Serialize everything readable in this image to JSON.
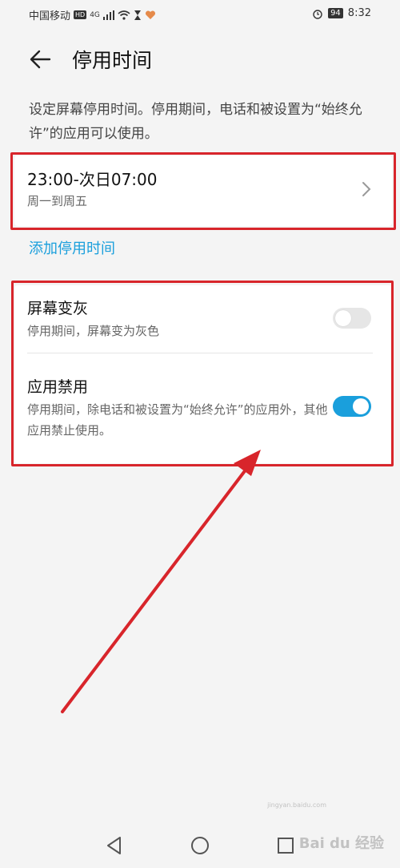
{
  "status_bar": {
    "carrier": "中国移动",
    "hd": "HD",
    "net": "4G",
    "battery": "94",
    "time": "8:32"
  },
  "header": {
    "title": "停用时间",
    "back_icon": "arrow-left-icon"
  },
  "description": "设定屏幕停用时间。停用期间，电话和被设置为“始终允许”的应用可以使用。",
  "schedule": {
    "time_range": "23:00-次日07:00",
    "days": "周一到周五"
  },
  "add_link": "添加停用时间",
  "settings": [
    {
      "title": "屏幕变灰",
      "subtitle": "停用期间，屏幕变为灰色",
      "enabled": false
    },
    {
      "title": "应用禁用",
      "subtitle": "停用期间，除电话和被设置为“始终允许”的应用外，其他应用禁止使用。",
      "enabled": true
    }
  ],
  "colors": {
    "accent": "#1a9fdc",
    "annotation": "#d8252b",
    "background": "#f4f4f4"
  },
  "watermark": "Bai du 经验",
  "watermark_sub": "jingyan.baidu.com"
}
